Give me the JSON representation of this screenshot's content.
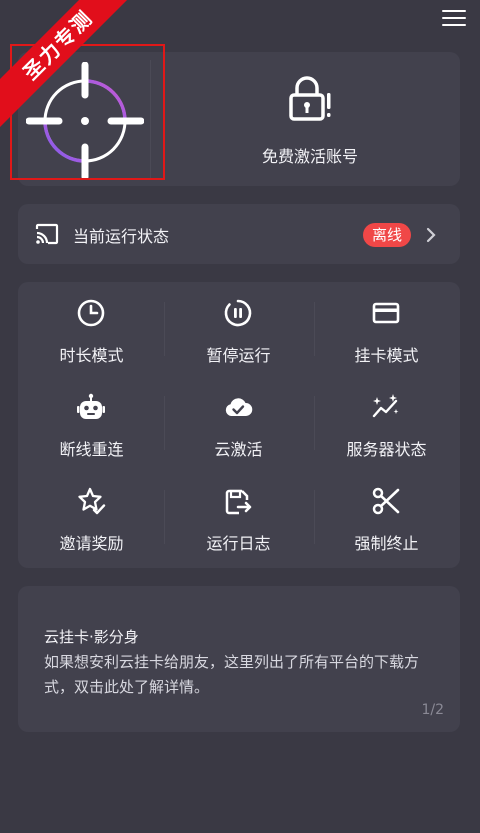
{
  "ribbon": {
    "text": "圣力专测"
  },
  "header": {
    "menu_icon": "hamburger-menu-icon"
  },
  "top": {
    "crosshair_icon": "crosshair-icon",
    "activate_icon": "lock-alert-icon",
    "activate_label": "免费激活账号"
  },
  "status": {
    "icon": "cast-icon",
    "label": "当前运行状态",
    "badge": "离线",
    "badge_color": "#f04747"
  },
  "grid": {
    "items": [
      {
        "label": "时长模式",
        "icon": "clock-icon"
      },
      {
        "label": "暂停运行",
        "icon": "pause-circle-icon"
      },
      {
        "label": "挂卡模式",
        "icon": "card-icon"
      },
      {
        "label": "断线重连",
        "icon": "robot-icon"
      },
      {
        "label": "云激活",
        "icon": "cloud-check-icon"
      },
      {
        "label": "服务器状态",
        "icon": "sparkle-chart-icon"
      },
      {
        "label": "邀请奖励",
        "icon": "star-check-icon"
      },
      {
        "label": "运行日志",
        "icon": "log-export-icon"
      },
      {
        "label": "强制终止",
        "icon": "scissors-icon"
      }
    ]
  },
  "news": {
    "title": "云挂卡·影分身",
    "body": "如果想安利云挂卡给朋友，这里列出了所有平台的下载方式，双击此处了解详情。",
    "page": "1/2"
  },
  "colors": {
    "background": "#3a3944",
    "card": "#42414d",
    "accent_purple": "#8e5cf0",
    "accent_pink": "#c65ad8",
    "badge": "#f04747"
  }
}
